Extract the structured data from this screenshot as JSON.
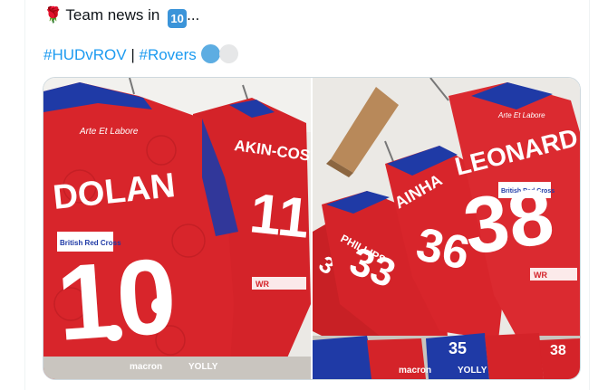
{
  "tweet": {
    "line1_text": "Team news in",
    "rose_emoji": "🌹",
    "keycap": "10",
    "ellipsis": "...",
    "hashtag1": "#HUDvROV",
    "separator": " | ",
    "hashtag2": "#Rovers"
  },
  "media": {
    "left_photo": {
      "badge": "Arte Et Labore",
      "name1": "DOLAN",
      "number1": "10",
      "name2": "AKIN-COSTELLO",
      "number2": "11",
      "sponsor": "British Red Cross",
      "footer_brand": "macron",
      "footer_partner": "YOLLY",
      "sleeve": "WR"
    },
    "right_photo": {
      "badge": "Arte Et Labore",
      "name1": "LEONARD",
      "number1": "38",
      "name2": "AINHA",
      "number2": "36",
      "name3": "PHILLIPS",
      "number3": "33",
      "sponsor": "British Red Cross",
      "footer_brand": "macron",
      "footer_partner": "YOLLY",
      "sleeve": "WR",
      "floor_number": "35",
      "floor_number2": "38"
    }
  },
  "colors": {
    "shirt_red": "#d8252b",
    "shirt_blue": "#1f3aa6",
    "link_blue": "#1d9bf0",
    "wall": "#e9e7e3"
  },
  "icons": [
    "rose-emoji-icon",
    "keycap-ten-icon",
    "blue-circle-icon",
    "white-circle-icon"
  ]
}
